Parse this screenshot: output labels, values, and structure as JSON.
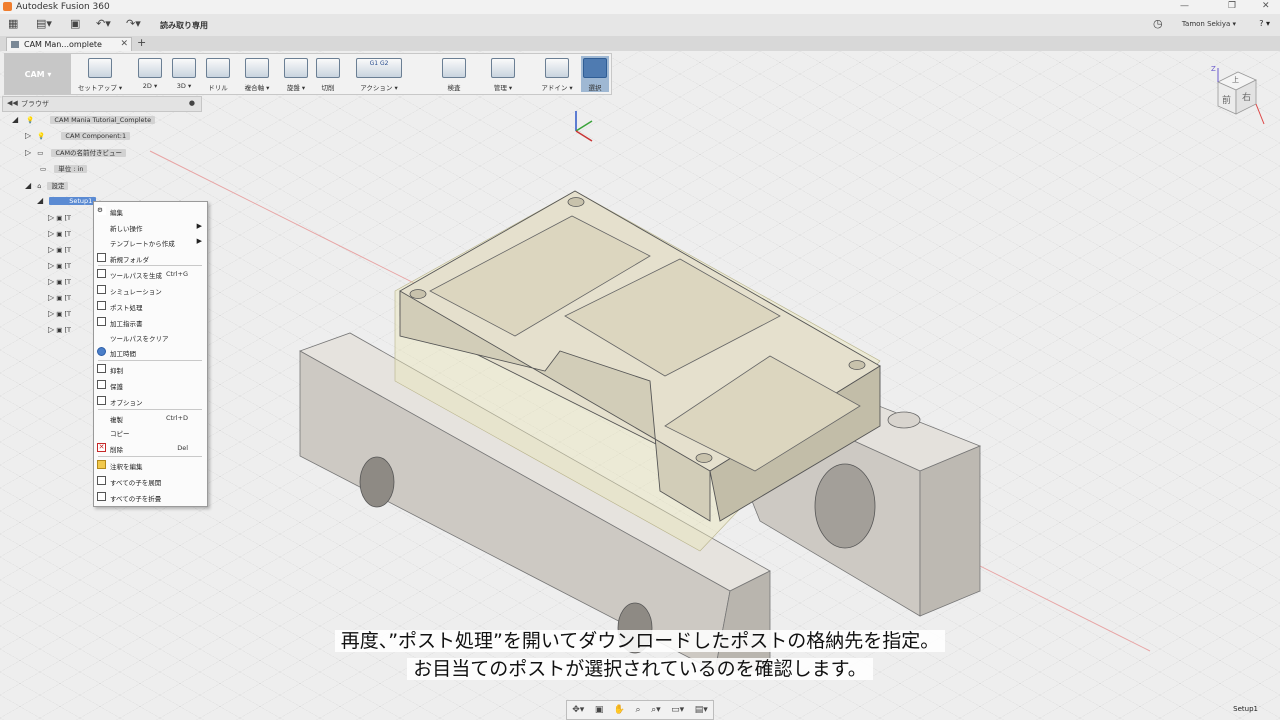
{
  "window": {
    "title": "Autodesk Fusion 360",
    "controls": [
      "—",
      "❐",
      "✕"
    ]
  },
  "quick_access": {
    "read_only_label": "読み取り専用",
    "user_name": "Tamon Sekiya ▾",
    "help": "? ▾"
  },
  "document_tab": {
    "label": "CAM Man...omplete",
    "close": "✕",
    "add": "+"
  },
  "toolbar": {
    "workspace": "CAM ▾",
    "tools": [
      {
        "label": "セットアップ ▾"
      },
      {
        "label": "2D ▾"
      },
      {
        "label": "3D ▾"
      },
      {
        "label": "ドリル"
      },
      {
        "label": "複合軸 ▾"
      },
      {
        "label": "旋盤 ▾"
      },
      {
        "label": "切削"
      },
      {
        "label": "アクション ▾"
      },
      {
        "label": "検査"
      },
      {
        "label": "管理 ▾"
      },
      {
        "label": "アドイン ▾"
      },
      {
        "label": "選択"
      }
    ],
    "actions_icon_text": [
      "G1",
      "G2"
    ]
  },
  "browser": {
    "title": "ブラウザ",
    "root": "CAM Mania Tutorial_Complete",
    "items": [
      {
        "label": "CAM Component:1"
      },
      {
        "label": "CAMの名前付きビュー"
      },
      {
        "label": "単位 : in"
      },
      {
        "label": "設定"
      },
      {
        "label": "Setup1"
      }
    ],
    "child_prefix": "[T"
  },
  "context_menu": {
    "items": [
      {
        "label": "編集"
      },
      {
        "label": "新しい操作",
        "submenu": true
      },
      {
        "label": "テンプレートから作成",
        "submenu": true
      },
      {
        "label": "新規フォルダ"
      },
      {
        "label": "ツールパスを生成",
        "shortcut": "Ctrl+G"
      },
      {
        "label": "シミュレーション"
      },
      {
        "label": "ポスト処理"
      },
      {
        "label": "加工指示書"
      },
      {
        "label": "ツールパスをクリア"
      },
      {
        "label": "加工時間"
      },
      {
        "label": "抑制"
      },
      {
        "label": "保護"
      },
      {
        "label": "オプション"
      },
      {
        "label": "複製",
        "shortcut": "Ctrl+D"
      },
      {
        "label": "コピー"
      },
      {
        "label": "削除",
        "shortcut": "Del"
      },
      {
        "label": "注釈を編集"
      },
      {
        "label": "すべての子を展開"
      },
      {
        "label": "すべての子を折畳"
      }
    ]
  },
  "viewcube": {
    "front": "前",
    "right": "右",
    "top": "上",
    "z": "Z"
  },
  "status": {
    "active_setup": "Setup1"
  },
  "subtitle": {
    "line1": "再度、”ポスト処理”を開いてダウンロードしたポストの格納先を指定。",
    "line2": "お目当てのポストが選択されているのを確認します。"
  },
  "colors": {
    "selection": "#5b8bd3",
    "part": "#dcd6c4",
    "fixture": "#cfcac3",
    "accent": "#4f7bb1"
  }
}
